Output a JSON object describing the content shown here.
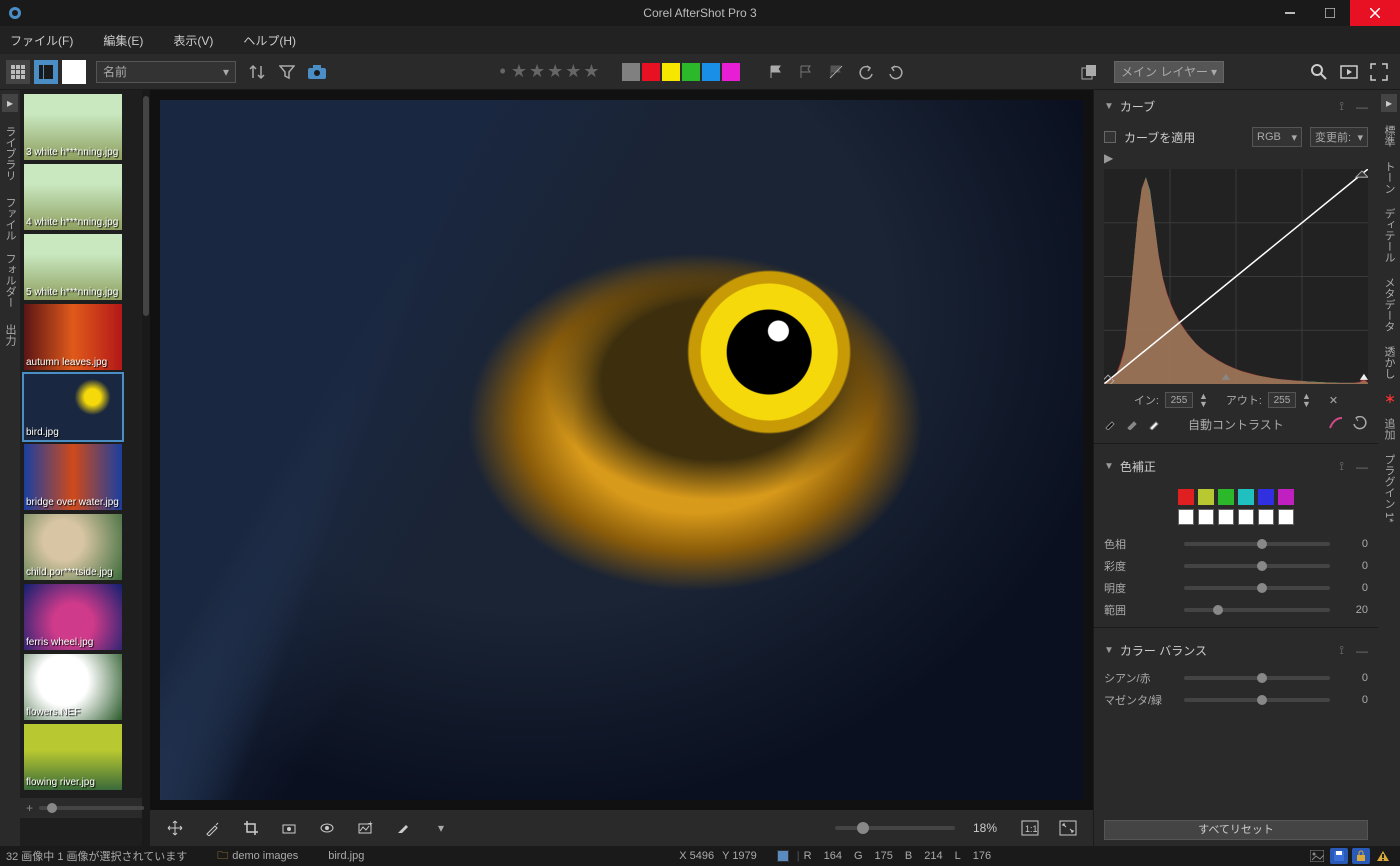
{
  "titlebar": {
    "title": "Corel AfterShot Pro 3"
  },
  "menu": {
    "file": "ファイル(F)",
    "edit": "編集(E)",
    "view": "表示(V)",
    "help": "ヘルプ(H)"
  },
  "toolbar": {
    "sort_label": "名前",
    "layer_label": "メイン レイヤー",
    "colors": [
      "#808080",
      "#e81123",
      "#f7e600",
      "#2bb82b",
      "#1a8fe8",
      "#e81ed4"
    ]
  },
  "left_tabs": {
    "library": "ライブラリ",
    "file_folder": "ファイル フォルダー",
    "output": "出力"
  },
  "thumbs": [
    {
      "label": "3 white h***nning.jpg",
      "fill": "f-white",
      "selected": false
    },
    {
      "label": "4 white h***nning.jpg",
      "fill": "f-white",
      "selected": false
    },
    {
      "label": "5 white h***nning.jpg",
      "fill": "f-white",
      "selected": false
    },
    {
      "label": "autumn leaves.jpg",
      "fill": "f-autumn",
      "selected": false
    },
    {
      "label": "bird.jpg",
      "fill": "f-bird",
      "selected": true
    },
    {
      "label": "bridge over water.jpg",
      "fill": "f-bridge",
      "selected": false
    },
    {
      "label": "child.por***tside.jpg",
      "fill": "f-child",
      "selected": false
    },
    {
      "label": "ferris wheel.jpg",
      "fill": "f-ferris",
      "selected": false
    },
    {
      "label": "flowers.NEF",
      "fill": "f-flowers",
      "selected": false
    },
    {
      "label": "flowing river.jpg",
      "fill": "f-river",
      "selected": false
    }
  ],
  "viewer": {
    "zoom": "18%"
  },
  "right_tabs": {
    "standard": "標準",
    "tone": "トーン",
    "detail": "ディテール",
    "metadata": "メタデータ",
    "watermark": "透かし",
    "add_star": "＊",
    "add": "追加",
    "plugin": "プラグイン 1*"
  },
  "panel": {
    "curves": {
      "title": "カーブ",
      "apply": "カーブを適用",
      "channel": "RGB",
      "before": "変更前:",
      "in_label": "イン:",
      "in_val": "255",
      "out_label": "アウト:",
      "out_val": "255",
      "autocontrast": "自動コントラスト"
    },
    "color_correction": {
      "title": "色補正",
      "hue": "色相",
      "hue_v": "0",
      "sat": "彩度",
      "sat_v": "0",
      "bri": "明度",
      "bri_v": "0",
      "rng": "範囲",
      "rng_v": "20",
      "colors": [
        "#e02020",
        "#b8c830",
        "#2bb82b",
        "#20c0c0",
        "#3030e0",
        "#c020c0"
      ]
    },
    "color_balance": {
      "title": "カラー バランス",
      "cyan": "シアン/赤",
      "cyan_v": "0",
      "magenta": "マゼンタ/緑",
      "magenta_v": "0"
    },
    "reset": "すべてリセット"
  },
  "chart_data": {
    "type": "histogram",
    "channels": [
      "R",
      "G",
      "B",
      "Luma"
    ],
    "x_range": [
      0,
      255
    ],
    "curve": [
      [
        0,
        0
      ],
      [
        255,
        255
      ]
    ],
    "R": [
      5,
      8,
      15,
      30,
      60,
      100,
      200,
      310,
      430,
      510,
      540,
      500,
      420,
      340,
      280,
      240,
      210,
      185,
      165,
      148,
      132,
      118,
      105,
      95,
      86,
      78,
      71,
      64,
      58,
      52,
      47,
      42,
      38,
      34,
      31,
      28,
      25,
      22,
      20,
      18,
      16,
      14,
      13,
      12,
      11,
      10,
      9,
      8,
      7,
      6,
      5,
      5,
      4,
      4,
      4,
      3,
      3,
      3,
      3,
      3,
      4,
      6,
      18,
      4
    ],
    "G": [
      4,
      6,
      12,
      25,
      50,
      90,
      190,
      305,
      420,
      500,
      530,
      495,
      415,
      330,
      270,
      230,
      200,
      178,
      158,
      142,
      127,
      114,
      102,
      92,
      83,
      75,
      68,
      61,
      55,
      50,
      45,
      40,
      36,
      32,
      29,
      26,
      23,
      21,
      19,
      17,
      15,
      14,
      12,
      11,
      10,
      9,
      8,
      8,
      7,
      6,
      6,
      5,
      5,
      4,
      4,
      4,
      3,
      3,
      3,
      3,
      3,
      4,
      6,
      3
    ],
    "B": [
      3,
      5,
      10,
      22,
      48,
      88,
      185,
      298,
      415,
      495,
      525,
      492,
      412,
      328,
      268,
      228,
      198,
      175,
      155,
      140,
      126,
      113,
      101,
      91,
      82,
      74,
      67,
      61,
      55,
      49,
      44,
      39,
      35,
      31,
      28,
      25,
      22,
      20,
      18,
      16,
      14,
      13,
      12,
      11,
      10,
      9,
      8,
      7,
      7,
      6,
      5,
      5,
      4,
      4,
      4,
      3,
      3,
      3,
      3,
      3,
      3,
      3,
      4,
      3
    ],
    "Luma": [
      4,
      6,
      12,
      26,
      53,
      93,
      192,
      304,
      422,
      502,
      532,
      496,
      416,
      333,
      273,
      233,
      203,
      179,
      159,
      143,
      128,
      115,
      103,
      93,
      84,
      76,
      69,
      62,
      56,
      50,
      45,
      40,
      36,
      32,
      29,
      26,
      23,
      21,
      19,
      17,
      15,
      13,
      12,
      11,
      10,
      9,
      8,
      8,
      7,
      6,
      6,
      5,
      5,
      4,
      4,
      4,
      3,
      3,
      3,
      3,
      3,
      4,
      10,
      3
    ]
  },
  "status": {
    "selection": "32 画像中 1 画像が選択されています",
    "folder": "demo images",
    "file": "bird.jpg",
    "xy": {
      "x": "X 5496",
      "y": "Y 1979"
    },
    "rgb": {
      "r_label": "R",
      "r": "164",
      "g_label": "G",
      "g": "175",
      "b_label": "B",
      "b": "214",
      "l_label": "L",
      "l": "176"
    }
  }
}
